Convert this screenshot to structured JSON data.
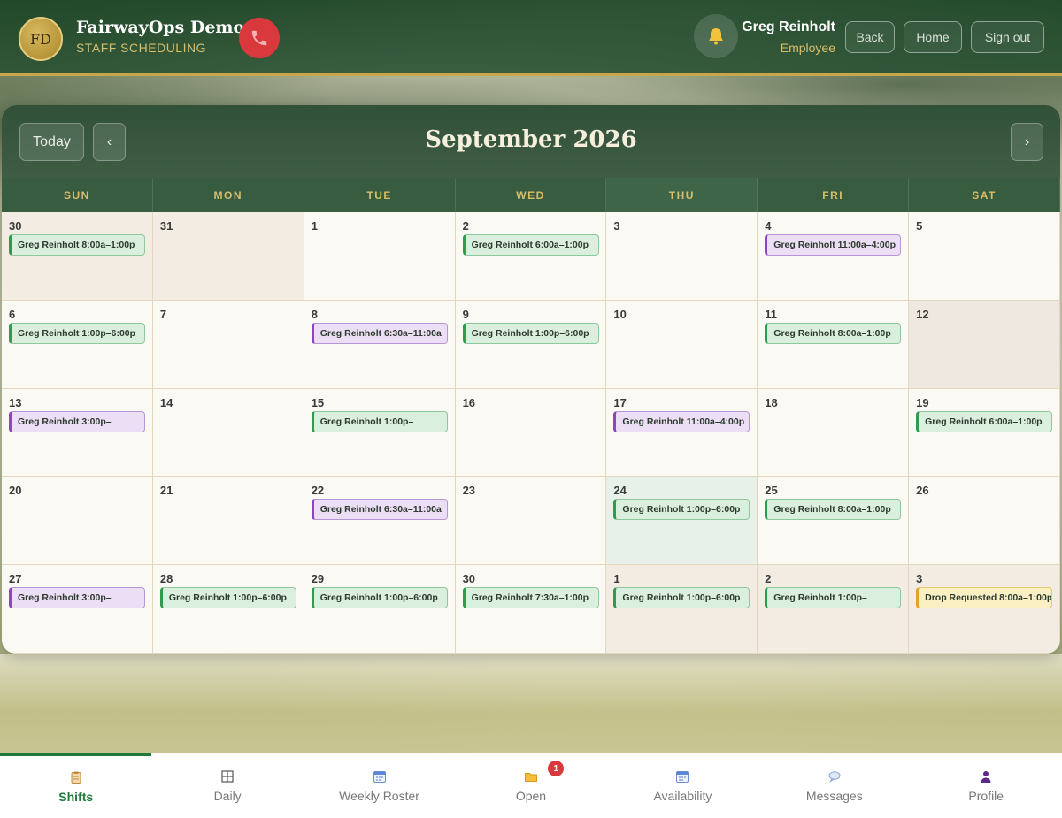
{
  "header": {
    "logo_text": "FD",
    "app_title": "FairwayOps Demo",
    "app_subtitle": "STAFF SCHEDULING",
    "user_name": "Greg Reinholt",
    "user_role": "Employee",
    "back_label": "Back",
    "home_label": "Home",
    "signout_label": "Sign out",
    "call_color": "#d9393c"
  },
  "calendar": {
    "today_label": "Today",
    "prev_label": "‹",
    "next_label": "›",
    "month_title": "September 2026",
    "weekdays": [
      "SUN",
      "MON",
      "TUE",
      "WED",
      "THU",
      "FRI",
      "SAT"
    ],
    "weeks": [
      [
        {
          "day": "30",
          "type": "other",
          "event": {
            "text": "Greg Reinholt 8:00a–1:00p",
            "color": "green"
          }
        },
        {
          "day": "31",
          "type": "other",
          "event": null
        },
        {
          "day": "1",
          "type": "normal",
          "event": null
        },
        {
          "day": "2",
          "type": "normal",
          "event": {
            "text": "Greg Reinholt 6:00a–1:00p",
            "color": "green"
          }
        },
        {
          "day": "3",
          "type": "normal",
          "event": null
        },
        {
          "day": "4",
          "type": "normal",
          "event": {
            "text": "Greg Reinholt 11:00a–4:00p",
            "color": "purple"
          }
        },
        {
          "day": "5",
          "type": "normal",
          "event": null
        }
      ],
      [
        {
          "day": "6",
          "type": "normal",
          "event": {
            "text": "Greg Reinholt 1:00p–6:00p",
            "color": "green"
          }
        },
        {
          "day": "7",
          "type": "normal",
          "event": null
        },
        {
          "day": "8",
          "type": "normal",
          "event": {
            "text": "Greg Reinholt 6:30a–11:00a",
            "color": "purple"
          }
        },
        {
          "day": "9",
          "type": "normal",
          "event": {
            "text": "Greg Reinholt 1:00p–6:00p",
            "color": "green"
          }
        },
        {
          "day": "10",
          "type": "normal",
          "event": null
        },
        {
          "day": "11",
          "type": "normal",
          "event": {
            "text": "Greg Reinholt 8:00a–1:00p",
            "color": "green"
          }
        },
        {
          "day": "12",
          "type": "shade",
          "event": null
        }
      ],
      [
        {
          "day": "13",
          "type": "normal",
          "event": {
            "text": "Greg Reinholt 3:00p–",
            "color": "purple"
          }
        },
        {
          "day": "14",
          "type": "normal",
          "event": null
        },
        {
          "day": "15",
          "type": "normal",
          "event": {
            "text": "Greg Reinholt 1:00p–",
            "color": "green"
          }
        },
        {
          "day": "16",
          "type": "normal",
          "event": null
        },
        {
          "day": "17",
          "type": "normal",
          "event": {
            "text": "Greg Reinholt 11:00a–4:00p",
            "color": "purple"
          }
        },
        {
          "day": "18",
          "type": "normal",
          "event": null
        },
        {
          "day": "19",
          "type": "normal",
          "event": {
            "text": "Greg Reinholt 6:00a–1:00p",
            "color": "green"
          }
        }
      ],
      [
        {
          "day": "20",
          "type": "normal",
          "event": null
        },
        {
          "day": "21",
          "type": "normal",
          "event": null
        },
        {
          "day": "22",
          "type": "normal",
          "event": {
            "text": "Greg Reinholt 6:30a–11:00a",
            "color": "purple"
          }
        },
        {
          "day": "23",
          "type": "normal",
          "event": null
        },
        {
          "day": "24",
          "type": "today",
          "event": {
            "text": "Greg Reinholt 1:00p–6:00p",
            "color": "green"
          }
        },
        {
          "day": "25",
          "type": "normal",
          "event": {
            "text": "Greg Reinholt 8:00a–1:00p",
            "color": "green"
          }
        },
        {
          "day": "26",
          "type": "normal",
          "event": null
        }
      ],
      [
        {
          "day": "27",
          "type": "normal",
          "event": {
            "text": "Greg Reinholt 3:00p–",
            "color": "purple"
          }
        },
        {
          "day": "28",
          "type": "normal",
          "event": {
            "text": "Greg Reinholt 1:00p–6:00p",
            "color": "green"
          }
        },
        {
          "day": "29",
          "type": "normal",
          "event": {
            "text": "Greg Reinholt 1:00p–6:00p",
            "color": "green"
          }
        },
        {
          "day": "30",
          "type": "normal",
          "event": {
            "text": "Greg Reinholt 7:30a–1:00p",
            "color": "green"
          }
        },
        {
          "day": "1",
          "type": "other",
          "event": {
            "text": "Greg Reinholt 1:00p–6:00p",
            "color": "green"
          }
        },
        {
          "day": "2",
          "type": "other",
          "event": {
            "text": "Greg Reinholt 1:00p–",
            "color": "green"
          }
        },
        {
          "day": "3",
          "type": "other",
          "event": {
            "text": "Drop Requested 8:00a–1:00p",
            "color": "yellow"
          }
        }
      ]
    ]
  },
  "nav": {
    "items": [
      {
        "label": "Shifts",
        "icon": "clipboard-icon",
        "active": true
      },
      {
        "label": "Daily",
        "icon": "grid-icon",
        "active": false
      },
      {
        "label": "Weekly Roster",
        "icon": "calendar-icon",
        "active": false
      },
      {
        "label": "Open",
        "icon": "folder-icon",
        "active": false,
        "badge": "1"
      },
      {
        "label": "Availability",
        "icon": "calendar-icon",
        "active": false
      },
      {
        "label": "Messages",
        "icon": "speech-bubble-icon",
        "active": false
      },
      {
        "label": "Profile",
        "icon": "person-icon",
        "active": false
      }
    ]
  }
}
